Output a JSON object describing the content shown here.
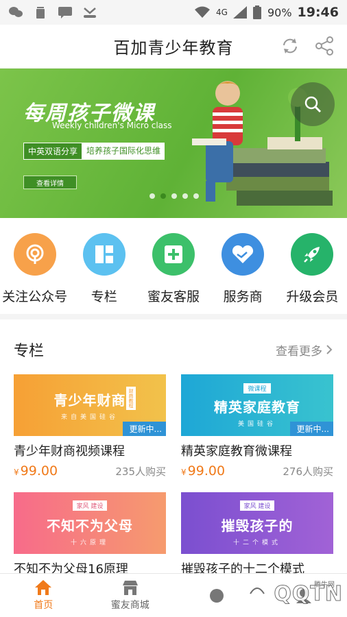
{
  "status_bar": {
    "battery": "90%",
    "time": "19:46",
    "network": "4G"
  },
  "header": {
    "title": "百加青少年教育"
  },
  "banner": {
    "title": "每周孩子微课",
    "subtitle": "Weekly children's Micro class",
    "tag_left": "中英双语分享",
    "tag_right": "培养孩子国际化思维",
    "detail_button": "查看详情",
    "slide_count": 5,
    "active_slide": 1
  },
  "menu": {
    "items": [
      {
        "label": "关注公众号",
        "icon": "wechat-official-icon",
        "color": "#f7a14a"
      },
      {
        "label": "专栏",
        "icon": "grid-icon",
        "color": "#5cc1f0"
      },
      {
        "label": "蜜友客服",
        "icon": "plus-box-icon",
        "color": "#3cc06a"
      },
      {
        "label": "服务商",
        "icon": "handshake-heart-icon",
        "color": "#3e8fe0"
      },
      {
        "label": "升级会员",
        "icon": "rocket-icon",
        "color": "#26b36a"
      }
    ]
  },
  "section": {
    "title": "专栏",
    "more": "查看更多"
  },
  "courses": [
    {
      "banner_text": "青少年财商",
      "banner_sub": "来自美国硅谷",
      "badge": "财商教程",
      "ribbon": "更新中...",
      "name": "青少年财商视频课程",
      "price": "99.00",
      "currency": "¥",
      "buys": "235人购买",
      "color_a": "#f6a035",
      "color_b": "#f2c24b"
    },
    {
      "banner_text": "精英家庭教育",
      "banner_sub": "美国硅谷",
      "badge": "微课程",
      "ribbon": "更新中...",
      "name": "精英家庭教育微课程",
      "price": "99.00",
      "currency": "¥",
      "buys": "276人购买",
      "color_a": "#1ea7d6",
      "color_b": "#39c3cf"
    },
    {
      "banner_text": "不知不为父母",
      "banner_sub": "十六原理",
      "badge": "家风 建设",
      "name": "不知不为父母16原理",
      "color_a": "#f76b8a",
      "color_b": "#f69b6e"
    },
    {
      "banner_text": "摧毁孩子的",
      "banner_sub": "十二个模式",
      "badge": "家风 建设",
      "name": "摧毁孩子的十二个模式",
      "color_a": "#7b4fd0",
      "color_b": "#a162d6"
    }
  ],
  "bottom_nav": {
    "items": [
      {
        "label": "首页",
        "icon": "home-icon",
        "active": true
      },
      {
        "label": "蜜友商城",
        "icon": "shop-icon",
        "active": false
      }
    ]
  },
  "watermark": {
    "text": "QQTN",
    "small": "腾牛网"
  },
  "colors": {
    "accent": "#f07a1a",
    "banner_green": "#5fb236"
  }
}
